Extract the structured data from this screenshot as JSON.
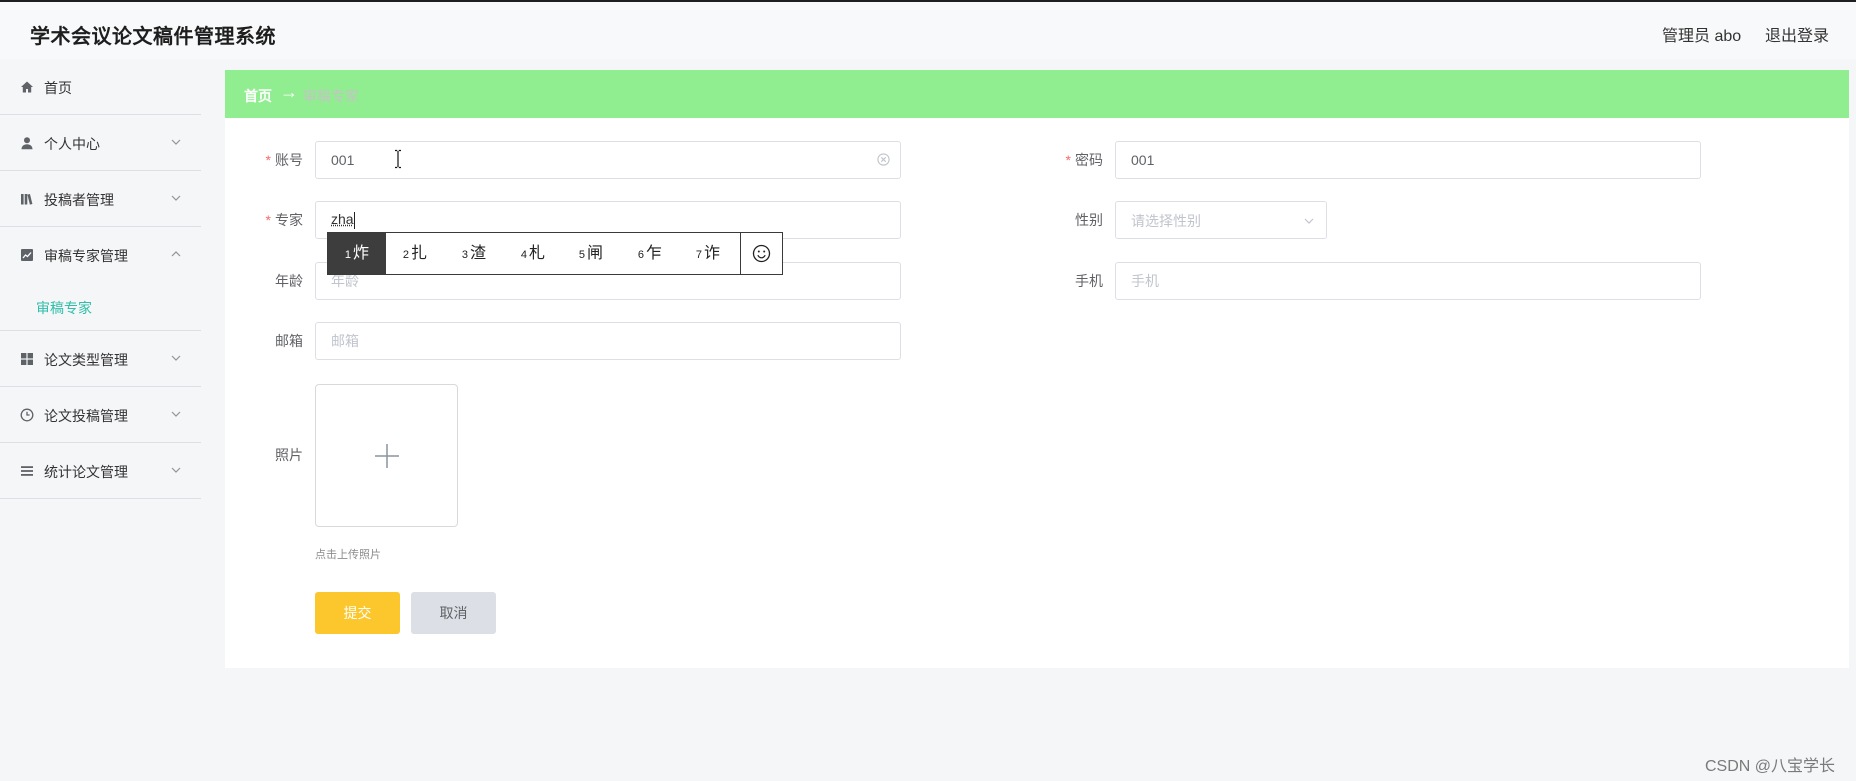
{
  "app": {
    "title": "学术会议论文稿件管理系统"
  },
  "header": {
    "user_label": "管理员 abo",
    "logout_label": "退出登录"
  },
  "sidebar": {
    "items": [
      {
        "label": "首页",
        "icon": "home-icon"
      },
      {
        "label": "个人中心",
        "icon": "user-icon"
      },
      {
        "label": "投稿者管理",
        "icon": "library-icon"
      },
      {
        "label": "审稿专家管理",
        "icon": "trend-chart-icon",
        "expanded": true,
        "children": [
          {
            "label": "审稿专家",
            "active": true
          }
        ]
      },
      {
        "label": "论文类型管理",
        "icon": "grid-icon"
      },
      {
        "label": "论文投稿管理",
        "icon": "clock-icon"
      },
      {
        "label": "统计论文管理",
        "icon": "list-icon"
      }
    ]
  },
  "breadcrumb": {
    "home": "首页",
    "separator": "→",
    "current": "审稿专家"
  },
  "form": {
    "required_mark": "*",
    "account": {
      "label": "账号",
      "value": "001"
    },
    "password": {
      "label": "密码",
      "value": "001"
    },
    "expert": {
      "label": "专家",
      "value": "zha"
    },
    "gender": {
      "label": "性别",
      "placeholder": "请选择性别"
    },
    "age": {
      "label": "年龄",
      "placeholder": "年龄"
    },
    "phone": {
      "label": "手机",
      "placeholder": "手机"
    },
    "email": {
      "label": "邮箱",
      "placeholder": "邮箱"
    },
    "photo": {
      "label": "照片",
      "upload_hint": "点击上传照片"
    },
    "submit_label": "提交",
    "cancel_label": "取消"
  },
  "ime": {
    "candidates": [
      {
        "index": "1",
        "char": "炸",
        "selected": true
      },
      {
        "index": "2",
        "char": "扎"
      },
      {
        "index": "3",
        "char": "渣"
      },
      {
        "index": "4",
        "char": "札"
      },
      {
        "index": "5",
        "char": "闸"
      },
      {
        "index": "6",
        "char": "乍"
      },
      {
        "index": "7",
        "char": "诈"
      }
    ],
    "emoji_icon": "smiley-icon"
  },
  "watermark": "CSDN @八宝学长",
  "colors": {
    "breadcrumb_bg": "#90ee90",
    "submit_bg": "#fcc62d",
    "cancel_bg": "#dcdfe6",
    "active_menu": "#2fbfa8",
    "required": "#f56c6c"
  }
}
